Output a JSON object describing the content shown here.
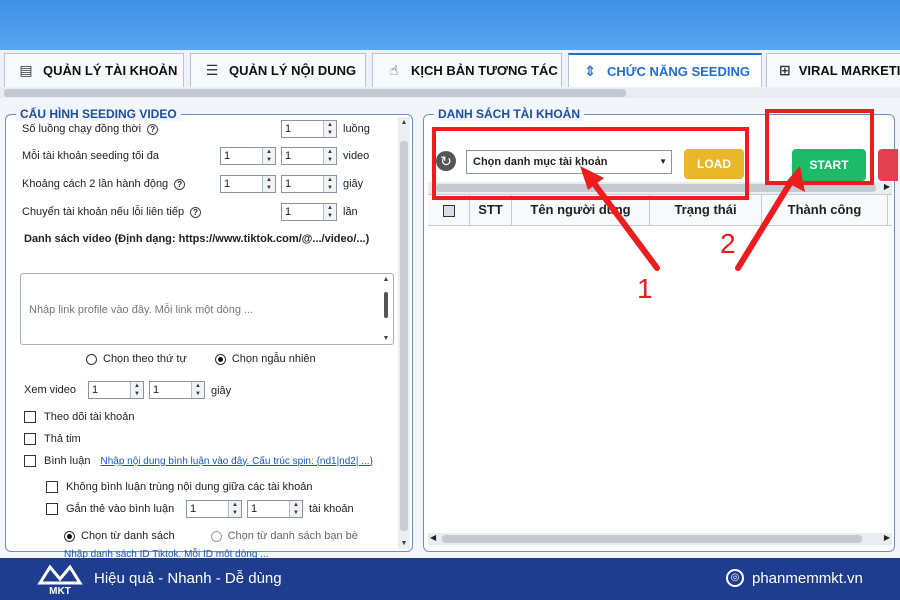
{
  "tabs": [
    {
      "label": "QUẢN LÝ TÀI KHOẢN",
      "icon": "id-card-icon"
    },
    {
      "label": "QUẢN LÝ NỘI DUNG",
      "icon": "list-icon"
    },
    {
      "label": "KỊCH BẢN TƯƠNG TÁC",
      "icon": "hand-pointer-icon"
    },
    {
      "label": "CHỨC NĂNG SEEDING",
      "icon": "expand-icon",
      "active": true
    },
    {
      "label": "VIRAL MARKETI",
      "icon": "grid-icon"
    }
  ],
  "left": {
    "title": "CẤU HÌNH SEEDING VIDEO",
    "threads": {
      "label": "Số luồng chạy đồng thời",
      "value": "1",
      "unit": "luồng"
    },
    "max_seed": {
      "label": "Mỗi tài khoản seeding tối đa",
      "min": "1",
      "max": "1",
      "unit": "video"
    },
    "interval": {
      "label": "Khoảng cách 2 lần hành động",
      "min": "1",
      "max": "1",
      "unit": "giây"
    },
    "switch_acc": {
      "label": "Chuyển tài khoản nếu lỗi liên tiếp",
      "value": "1",
      "unit": "lần"
    },
    "video_list_label": "Danh sách video (Định dạng: https://www.tiktok.com/@.../video/...)",
    "video_list_placeholder": "Nhập link profile vào đây. Mỗi link một dòng ...",
    "order_seq": "Chọn theo thứ tự",
    "order_rand": "Chọn ngẫu nhiên",
    "watch": {
      "label": "Xem video",
      "min": "1",
      "max": "1",
      "unit": "giây"
    },
    "follow": "Theo dõi tài khoản",
    "like": "Thả tim",
    "comment": "Bình luận",
    "comment_link": "Nhập nội dung bình luận vào đây. Cấu trúc spin: {nd1|nd2| ...}",
    "no_dup": "Không bình luận trùng nội dung giữa các tài khoản",
    "tag": {
      "label": "Gắn thẻ vào bình luận",
      "min": "1",
      "max": "1",
      "unit": "tài khoản"
    },
    "from_list": "Chọn từ danh sách",
    "from_friends": "Chọn từ danh sách bạn bè",
    "id_link": "Nhập danh sách ID Tiktok. Mỗi ID một dòng ..."
  },
  "right": {
    "title": "DANH SÁCH TÀI KHOẢN",
    "combo": "Chọn danh mục tài khoản",
    "load": "LOAD",
    "start": "START",
    "cols": [
      "STT",
      "Tên người dùng",
      "Trạng thái",
      "Thành công"
    ]
  },
  "annotations": {
    "n1": "1",
    "n2": "2"
  },
  "footer": {
    "slogan": "Hiệu quả - Nhanh - Dễ dùng",
    "site": "phanmemmkt.vn",
    "logo": "MKT"
  },
  "colors": {
    "accent": "#1e6fd9",
    "load": "#e8b72a",
    "start": "#1dba6a",
    "highlight": "#ee1c1c",
    "footer": "#1e3d8f"
  }
}
